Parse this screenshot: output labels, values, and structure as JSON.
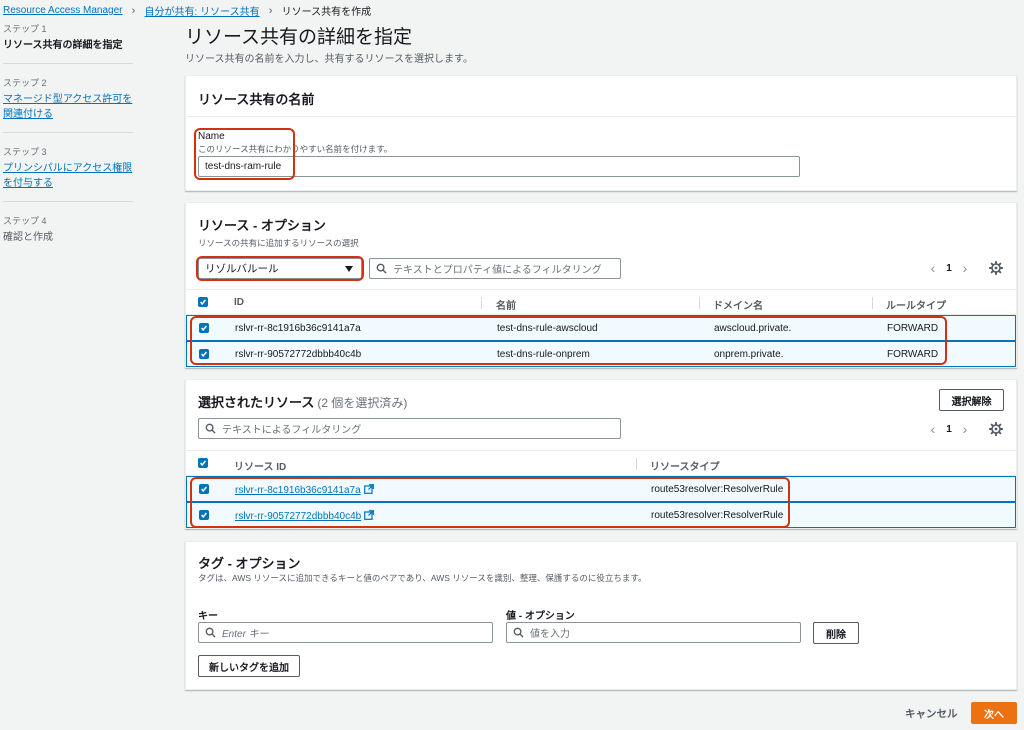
{
  "breadcrumb": {
    "items": [
      "Resource Access Manager",
      "自分が共有: リソース共有"
    ],
    "current": "リソース共有を作成"
  },
  "steps": [
    {
      "num": "ステップ 1",
      "label": "リソース共有の詳細を指定"
    },
    {
      "num": "ステップ 2",
      "label": "マネージド型アクセス許可を関連付ける"
    },
    {
      "num": "ステップ 3",
      "label": "プリンシパルにアクセス権限を付与する"
    },
    {
      "num": "ステップ 4",
      "label": "確認と作成"
    }
  ],
  "page": {
    "title": "リソース共有の詳細を指定",
    "description": "リソース共有の名前を入力し、共有するリソースを選択します。"
  },
  "name_panel": {
    "title": "リソース共有の名前",
    "field_label": "Name",
    "field_hint": "このリソース共有にわかりやすい名前を付けます。",
    "field_value": "test-dns-ram-rule"
  },
  "resources_panel": {
    "title": "リソース - オプション",
    "subtitle": "リソースの共有に追加するリソースの選択",
    "resource_type_selected": "リゾルバルール",
    "filter_placeholder": "テキストとプロパティ値によるフィルタリング",
    "page_number": "1",
    "columns": [
      "ID",
      "名前",
      "ドメイン名",
      "ルールタイプ"
    ],
    "rows": [
      {
        "id": "rslvr-rr-8c1916b36c9141a7a",
        "name": "test-dns-rule-awscloud",
        "domain": "awscloud.private.",
        "type": "FORWARD"
      },
      {
        "id": "rslvr-rr-90572772dbbb40c4b",
        "name": "test-dns-rule-onprem",
        "domain": "onprem.private.",
        "type": "FORWARD"
      }
    ]
  },
  "selected_panel": {
    "title": "選択されたリソース",
    "count_text": "(2 個を選択済み)",
    "deselect_label": "選択解除",
    "filter_placeholder": "テキストによるフィルタリング",
    "page_number": "1",
    "columns": [
      "リソース ID",
      "リソースタイプ"
    ],
    "rows": [
      {
        "id": "rslvr-rr-8c1916b36c9141a7a",
        "type": "route53resolver:ResolverRule"
      },
      {
        "id": "rslvr-rr-90572772dbbb40c4b",
        "type": "route53resolver:ResolverRule"
      }
    ]
  },
  "tags_panel": {
    "title": "タグ - オプション",
    "subtitle": "タグは、AWS リソースに追加できるキーと値のペアであり、AWS リソースを識別、整理、保護するのに役立ちます。",
    "key_label": "キー",
    "key_placeholder": "Enter キー",
    "value_label": "値 - オプション",
    "value_placeholder": "値を入力",
    "remove_label": "削除",
    "add_tag_label": "新しいタグを追加"
  },
  "footer": {
    "cancel_label": "キャンセル",
    "next_label": "次へ"
  },
  "colors": {
    "accent": "#0073bb",
    "primary_button": "#ec7211",
    "highlight_box": "#d13212",
    "selected_row_bg": "#f1faff"
  }
}
